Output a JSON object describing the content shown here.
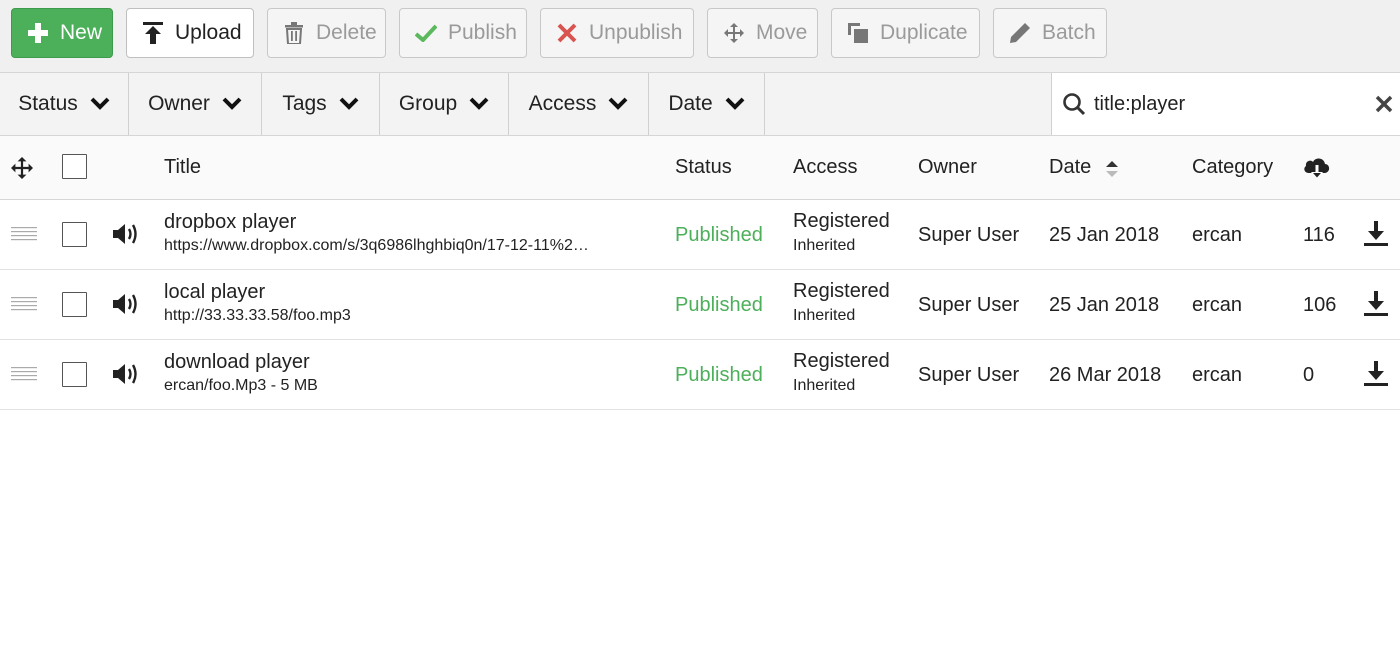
{
  "toolbar": {
    "new": "New",
    "upload": "Upload",
    "delete": "Delete",
    "publish": "Publish",
    "unpublish": "Unpublish",
    "move": "Move",
    "duplicate": "Duplicate",
    "batch": "Batch"
  },
  "filters": {
    "status": "Status",
    "owner": "Owner",
    "tags": "Tags",
    "group": "Group",
    "access": "Access",
    "date": "Date"
  },
  "search": {
    "value": "title:player"
  },
  "columns": {
    "title": "Title",
    "status": "Status",
    "access": "Access",
    "owner": "Owner",
    "date": "Date",
    "category": "Category"
  },
  "rows": [
    {
      "title": "dropbox player",
      "subtitle": "https://www.dropbox.com/s/3q6986lhghbiq0n/17-12-11%2…",
      "status": "Published",
      "access": "Registered",
      "access_sub": "Inherited",
      "owner": "Super User",
      "date": "25 Jan 2018",
      "category": "ercan",
      "downloads": "116"
    },
    {
      "title": "local player",
      "subtitle": "http://33.33.33.58/foo.mp3",
      "status": "Published",
      "access": "Registered",
      "access_sub": "Inherited",
      "owner": "Super User",
      "date": "25 Jan 2018",
      "category": "ercan",
      "downloads": "106"
    },
    {
      "title": "download player",
      "subtitle": "ercan/foo.Mp3 - 5 MB",
      "status": "Published",
      "access": "Registered",
      "access_sub": "Inherited",
      "owner": "Super User",
      "date": "26 Mar 2018",
      "category": "ercan",
      "downloads": "0"
    }
  ],
  "colors": {
    "new_button": "#4caf5a",
    "published": "#4caf5a",
    "unpublish_icon": "#d9534f",
    "publish_icon": "#5cb85c"
  }
}
